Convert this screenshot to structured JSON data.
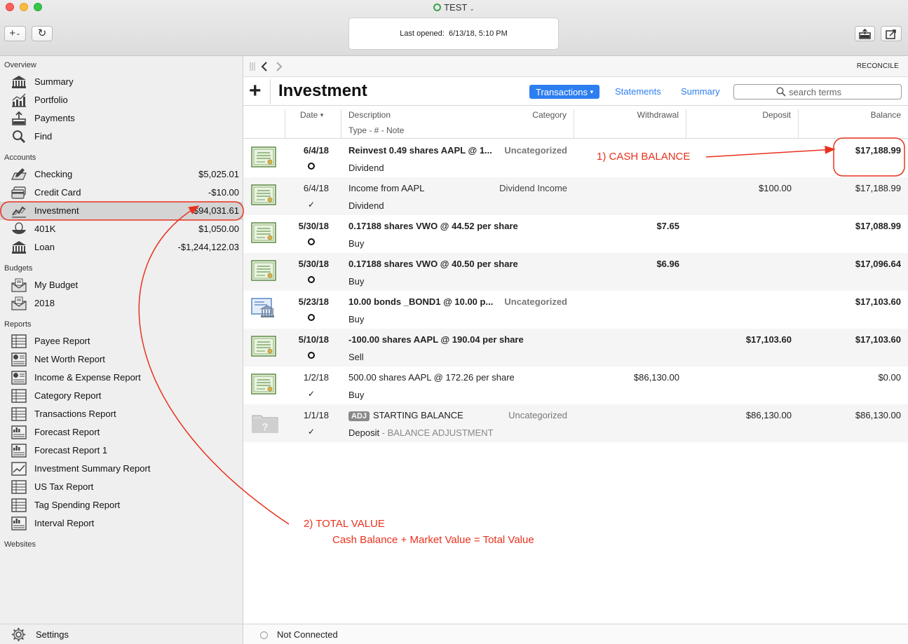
{
  "window": {
    "title": "TEST",
    "last_opened_label": "Last opened:",
    "last_opened_value": "6/13/18, 5:10 PM"
  },
  "toolbar": {
    "add_symbol": "+",
    "add_chevron": "⌄",
    "refresh_symbol": "↻"
  },
  "sidebar": {
    "overview_label": "Overview",
    "overview": [
      {
        "label": "Summary",
        "icon": "bank-icon"
      },
      {
        "label": "Portfolio",
        "icon": "portfolio-chart-icon"
      },
      {
        "label": "Payments",
        "icon": "upload-tray-icon"
      },
      {
        "label": "Find",
        "icon": "magnifier-icon"
      }
    ],
    "accounts_label": "Accounts",
    "accounts": [
      {
        "label": "Checking",
        "amount": "$5,025.01",
        "icon": "checkbook-icon"
      },
      {
        "label": "Credit Card",
        "amount": "-$10.00",
        "icon": "credit-card-icon"
      },
      {
        "label": "Investment",
        "amount": "$94,031.61",
        "icon": "investment-chart-icon"
      },
      {
        "label": "401K",
        "amount": "$1,050.00",
        "icon": "nest-egg-icon"
      },
      {
        "label": "Loan",
        "amount": "-$1,244,122.03",
        "icon": "bank-icon"
      }
    ],
    "budgets_label": "Budgets",
    "budgets": [
      {
        "label": "My Budget",
        "icon": "envelope-icon"
      },
      {
        "label": "2018",
        "icon": "envelope-icon"
      }
    ],
    "reports_label": "Reports",
    "reports": [
      {
        "label": "Payee Report",
        "icon": "table-report-icon"
      },
      {
        "label": "Net Worth Report",
        "icon": "pie-report-icon"
      },
      {
        "label": "Income & Expense Report",
        "icon": "pie-report-icon"
      },
      {
        "label": "Category Report",
        "icon": "table-report-icon"
      },
      {
        "label": "Transactions Report",
        "icon": "table-report-icon"
      },
      {
        "label": "Forecast Report",
        "icon": "bar-report-icon"
      },
      {
        "label": "Forecast Report 1",
        "icon": "bar-report-icon"
      },
      {
        "label": "Investment Summary Report",
        "icon": "line-report-icon"
      },
      {
        "label": "US Tax Report",
        "icon": "table-report-icon"
      },
      {
        "label": "Tag Spending Report",
        "icon": "table-report-icon"
      },
      {
        "label": "Interval Report",
        "icon": "bar-report-icon"
      }
    ],
    "websites_label": "Websites",
    "settings_label": "Settings"
  },
  "main": {
    "reconcile_label": "RECONCILE",
    "account_title": "Investment",
    "tabs": {
      "transactions": "Transactions",
      "statements": "Statements",
      "summary": "Summary"
    },
    "search_placeholder": "search terms",
    "columns": {
      "date": "Date",
      "description": "Description",
      "category": "Category",
      "type_line": "Type  -  #  -  Note",
      "withdrawal": "Withdrawal",
      "deposit": "Deposit",
      "balance": "Balance"
    },
    "transactions": [
      {
        "date": "6/4/18",
        "desc": "Reinvest 0.49 shares AAPL @ 1...",
        "category": "Uncategorized",
        "type": "Dividend",
        "withdrawal": "",
        "deposit": "",
        "balance": "$17,188.99",
        "status": "○",
        "icon": "stock-certificate-icon"
      },
      {
        "date": "6/4/18",
        "desc": "Income from AAPL",
        "category": "Dividend Income",
        "type": "Dividend",
        "withdrawal": "",
        "deposit": "$100.00",
        "balance": "$17,188.99",
        "status": "✓",
        "icon": "stock-certificate-icon"
      },
      {
        "date": "5/30/18",
        "desc": "0.17188 shares VWO @ 44.52 per share",
        "category": "",
        "type": "Buy",
        "withdrawal": "$7.65",
        "deposit": "",
        "balance": "$17,088.99",
        "status": "○",
        "icon": "stock-certificate-icon"
      },
      {
        "date": "5/30/18",
        "desc": "0.17188 shares VWO @ 40.50 per share",
        "category": "",
        "type": "Buy",
        "withdrawal": "$6.96",
        "deposit": "",
        "balance": "$17,096.64",
        "status": "○",
        "icon": "stock-certificate-icon"
      },
      {
        "date": "5/23/18",
        "desc": "10.00 bonds _BOND1 @ 10.00 p...",
        "category": "Uncategorized",
        "type": "Buy",
        "withdrawal": "",
        "deposit": "",
        "balance": "$17,103.60",
        "status": "○",
        "icon": "bond-bank-icon"
      },
      {
        "date": "5/10/18",
        "desc": "-100.00 shares AAPL @ 190.04 per share",
        "category": "",
        "type": "Sell",
        "withdrawal": "",
        "deposit": "$17,103.60",
        "balance": "$17,103.60",
        "status": "○",
        "icon": "stock-certificate-icon"
      },
      {
        "date": "1/2/18",
        "desc": "500.00 shares AAPL @ 172.26 per share",
        "category": "",
        "type": "Buy",
        "withdrawal": "$86,130.00",
        "deposit": "",
        "balance": "$0.00",
        "status": "✓",
        "icon": "stock-certificate-icon"
      },
      {
        "date": "1/1/18",
        "badge": "ADJ",
        "desc": "STARTING BALANCE",
        "category": "Uncategorized",
        "type": "Deposit",
        "memo": " - BALANCE ADJUSTMENT",
        "withdrawal": "",
        "deposit": "$86,130.00",
        "balance": "$86,130.00",
        "status": "✓",
        "icon": "unknown-folder-icon"
      }
    ]
  },
  "footer": {
    "connection_status": "Not Connected"
  },
  "annotations": {
    "cash_balance": "1) CASH BALANCE",
    "total_value": "2) TOTAL VALUE",
    "total_value_formula": "Cash Balance + Market Value = Total Value"
  },
  "colors": {
    "accent": "#2d7ef0",
    "annotation": "#e8321e"
  }
}
